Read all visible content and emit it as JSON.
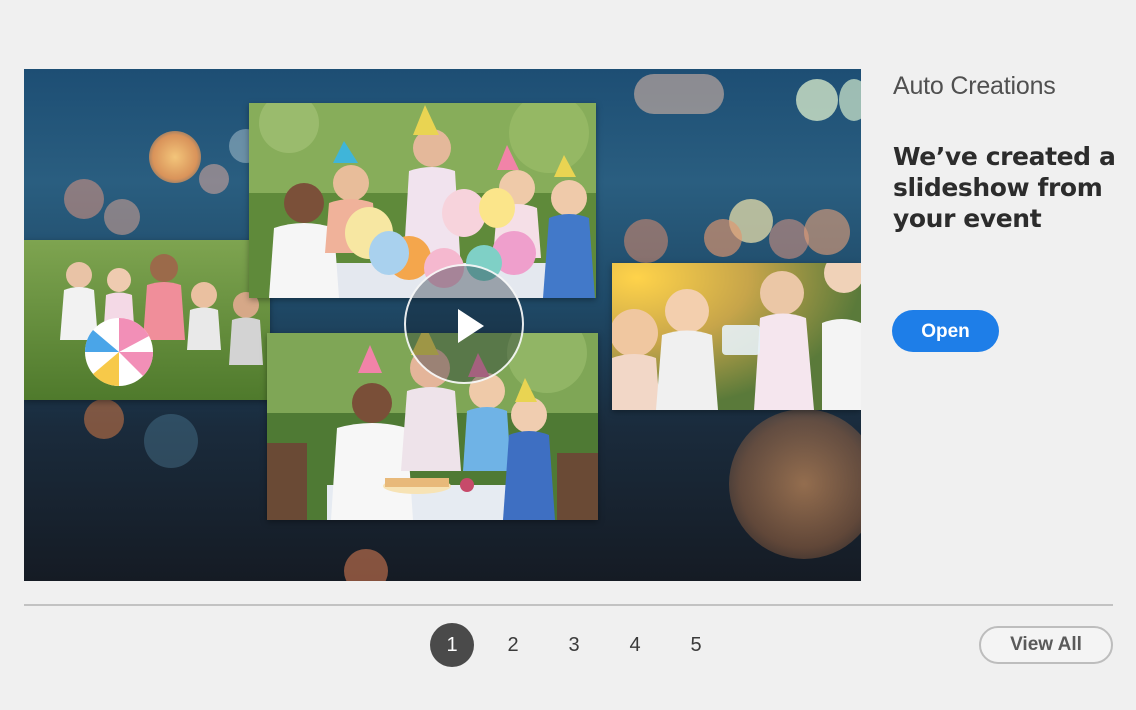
{
  "section": {
    "title": "Auto Creations"
  },
  "card": {
    "headline": "We’ve created a slideshow from your event",
    "open_label": "Open",
    "media_type": "slideshow",
    "play_icon": "play-icon"
  },
  "pagination": {
    "pages": [
      "1",
      "2",
      "3",
      "4",
      "5"
    ],
    "current": "1",
    "view_all_label": "View All"
  },
  "colors": {
    "accent": "#1e7ee8",
    "page_active": "#4a4a4a",
    "background": "#f0f0f0"
  }
}
